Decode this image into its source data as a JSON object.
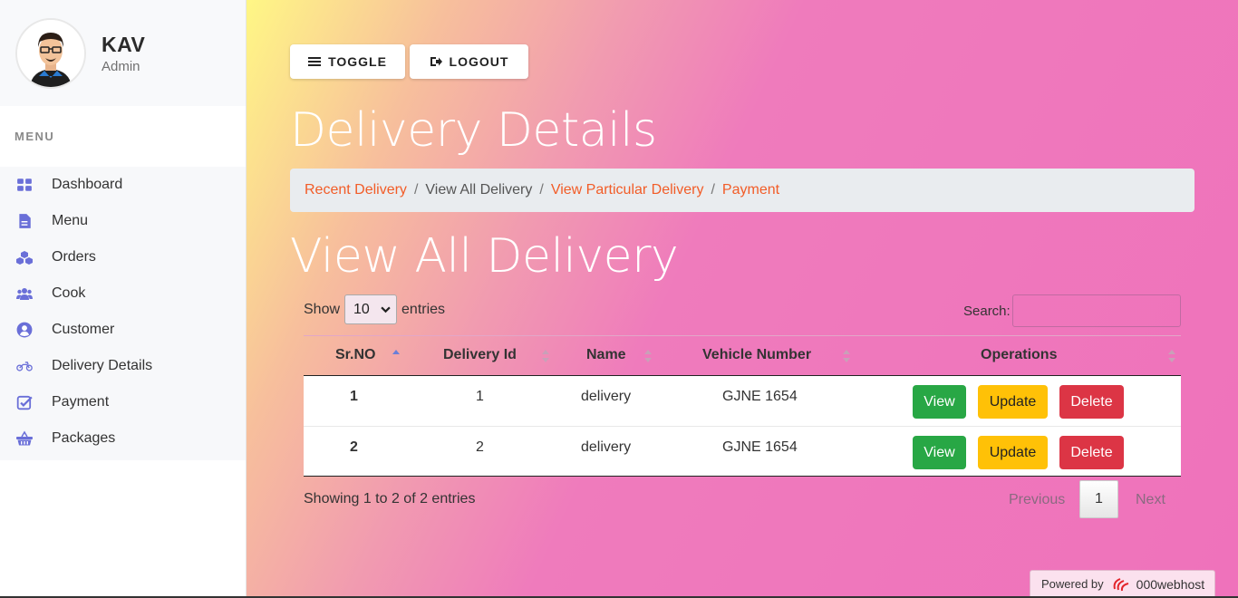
{
  "user": {
    "name": "KAV",
    "role": "Admin"
  },
  "sidebar": {
    "menu_heading": "MENU",
    "items": [
      {
        "label": "Dashboard",
        "icon": "dashboard-icon"
      },
      {
        "label": "Menu",
        "icon": "document-icon"
      },
      {
        "label": "Orders",
        "icon": "cubes-icon"
      },
      {
        "label": "Cook",
        "icon": "users-icon"
      },
      {
        "label": "Customer",
        "icon": "user-circle-icon"
      },
      {
        "label": "Delivery Details",
        "icon": "motorcycle-icon"
      },
      {
        "label": "Payment",
        "icon": "check-square-icon"
      },
      {
        "label": "Packages",
        "icon": "basket-icon"
      }
    ]
  },
  "toolbar": {
    "toggle_label": "TOGGLE",
    "logout_label": "LOGOUT"
  },
  "page": {
    "title": "Delivery Details",
    "subtitle": "View All Delivery"
  },
  "breadcrumb": {
    "items": [
      "Recent Delivery",
      "View All Delivery",
      "View Particular Delivery",
      "Payment"
    ],
    "separator": "/"
  },
  "table_controls": {
    "show_label": "Show",
    "entries_value": "10",
    "entries_label": "entries",
    "search_label": "Search:",
    "search_value": ""
  },
  "table": {
    "columns": [
      "Sr.NO",
      "Delivery Id",
      "Name",
      "Vehicle Number",
      "Operations"
    ],
    "rows": [
      {
        "sr": "1",
        "id": "1",
        "name": "delivery",
        "vehicle": "GJNE 1654"
      },
      {
        "sr": "2",
        "id": "2",
        "name": "delivery",
        "vehicle": "GJNE 1654"
      }
    ],
    "actions": {
      "view": "View",
      "update": "Update",
      "delete": "Delete"
    }
  },
  "pagination": {
    "info": "Showing 1 to 2 of 2 entries",
    "previous": "Previous",
    "current": "1",
    "next": "Next"
  },
  "footer": {
    "powered_label": "Powered by",
    "brand": "000webhost"
  },
  "colors": {
    "accent": "#6a6fd8",
    "link": "#f25c27",
    "view": "#28a745",
    "update": "#ffc107",
    "delete": "#dc3545"
  }
}
